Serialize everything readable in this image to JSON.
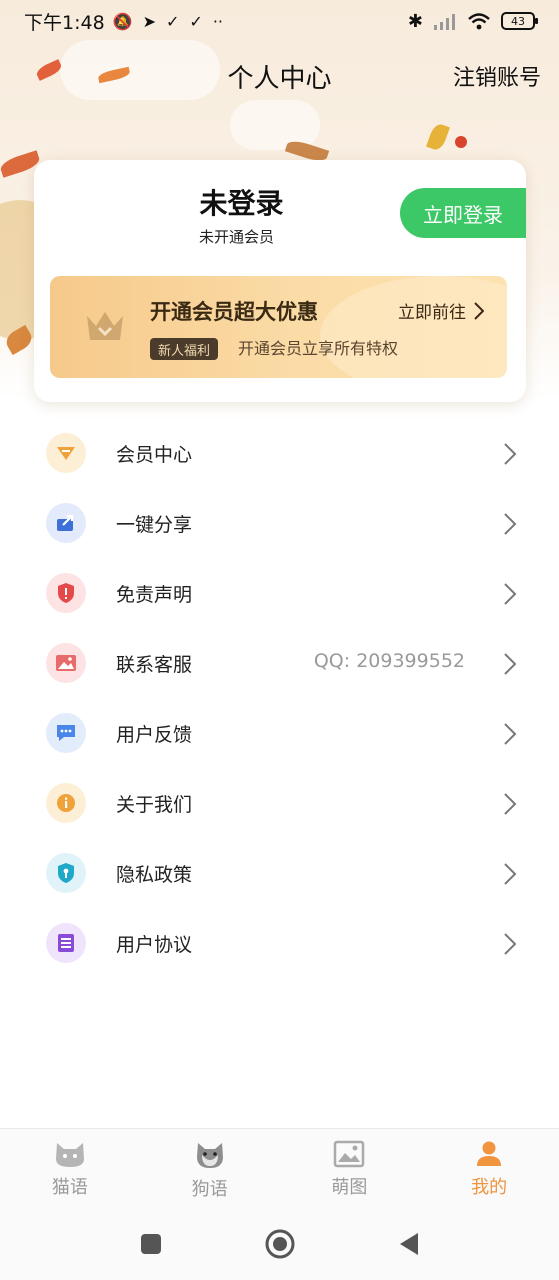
{
  "status_bar": {
    "time": "下午1:48",
    "battery": "43"
  },
  "header": {
    "title": "个人中心",
    "logout_label": "注销账号"
  },
  "profile": {
    "login_status": "未登录",
    "member_status": "未开通会员",
    "login_button": "立即登录"
  },
  "vip_banner": {
    "title": "开通会员超大优惠",
    "go_label": "立即前往",
    "tag": "新人福利",
    "subtitle": "开通会员立享所有特权"
  },
  "menu": {
    "items": [
      {
        "label": "会员中心",
        "icon": "vip-icon",
        "color": "#f0a23a",
        "bg": "#fdefd6",
        "extra": ""
      },
      {
        "label": "一键分享",
        "icon": "share-icon",
        "color": "#3d6fd9",
        "bg": "#e2eafb",
        "extra": ""
      },
      {
        "label": "免责声明",
        "icon": "shield-alert-icon",
        "color": "#e54a4a",
        "bg": "#fde3e3",
        "extra": ""
      },
      {
        "label": "联系客服",
        "icon": "image-icon",
        "color": "#e86b6b",
        "bg": "#fde3e3",
        "extra": "QQ: 209399552"
      },
      {
        "label": "用户反馈",
        "icon": "chat-icon",
        "color": "#4a86e8",
        "bg": "#e2ecfb",
        "extra": ""
      },
      {
        "label": "关于我们",
        "icon": "info-icon",
        "color": "#f0a23a",
        "bg": "#fdefd6",
        "extra": ""
      },
      {
        "label": "隐私政策",
        "icon": "privacy-shield-icon",
        "color": "#1fa8c8",
        "bg": "#dff3f8",
        "extra": ""
      },
      {
        "label": "用户协议",
        "icon": "document-icon",
        "color": "#8a4ad9",
        "bg": "#efe4fb",
        "extra": ""
      }
    ]
  },
  "bottom_nav": {
    "items": [
      {
        "label": "猫语",
        "icon": "cat-icon"
      },
      {
        "label": "狗语",
        "icon": "dog-icon"
      },
      {
        "label": "萌图",
        "icon": "picture-icon"
      },
      {
        "label": "我的",
        "icon": "person-icon",
        "active": true
      }
    ],
    "active_color": "#f0943f"
  }
}
